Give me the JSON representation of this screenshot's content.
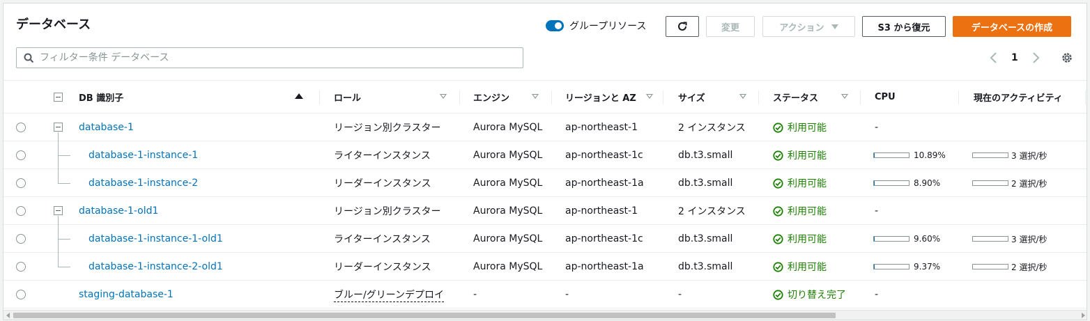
{
  "header": {
    "title": "データベース",
    "group_toggle_label": "グループリソース",
    "modify_label": "変更",
    "actions_label": "アクション",
    "restore_label": "S3 から復元",
    "create_label": "データベースの作成"
  },
  "search": {
    "placeholder": "フィルター条件 データベース"
  },
  "pager": {
    "page": "1"
  },
  "columns": {
    "db_id": "DB 識別子",
    "role": "ロール",
    "engine": "エンジン",
    "region": "リージョンと AZ",
    "size": "サイズ",
    "status": "ステータス",
    "cpu": "CPU",
    "activity": "現在のアクティビティ"
  },
  "rows": [
    {
      "id": "database-1",
      "role": "リージョン別クラスター",
      "engine": "Aurora MySQL",
      "region": "ap-northeast-1",
      "size": "2 インスタンス",
      "status": "利用可能",
      "cpu": "-",
      "activity": ""
    },
    {
      "id": "database-1-instance-1",
      "role": "ライターインスタンス",
      "engine": "Aurora MySQL",
      "region": "ap-northeast-1c",
      "size": "db.t3.small",
      "status": "利用可能",
      "cpu": "10.89%",
      "cpu_value": 10.89,
      "activity": "3 選択/秒"
    },
    {
      "id": "database-1-instance-2",
      "role": "リーダーインスタンス",
      "engine": "Aurora MySQL",
      "region": "ap-northeast-1a",
      "size": "db.t3.small",
      "status": "利用可能",
      "cpu": "8.90%",
      "cpu_value": 8.9,
      "activity": "2 選択/秒"
    },
    {
      "id": "database-1-old1",
      "role": "リージョン別クラスター",
      "engine": "Aurora MySQL",
      "region": "ap-northeast-1",
      "size": "2 インスタンス",
      "status": "利用可能",
      "cpu": "-",
      "activity": ""
    },
    {
      "id": "database-1-instance-1-old1",
      "role": "ライターインスタンス",
      "engine": "Aurora MySQL",
      "region": "ap-northeast-1c",
      "size": "db.t3.small",
      "status": "利用可能",
      "cpu": "9.60%",
      "cpu_value": 9.6,
      "activity": "3 選択/秒"
    },
    {
      "id": "database-1-instance-2-old1",
      "role": "リーダーインスタンス",
      "engine": "Aurora MySQL",
      "region": "ap-northeast-1a",
      "size": "db.t3.small",
      "status": "利用可能",
      "cpu": "9.37%",
      "cpu_value": 9.37,
      "activity": "2 選択/秒"
    },
    {
      "id": "staging-database-1",
      "role": "ブルー/グリーンデプロイ",
      "engine": "-",
      "region": "-",
      "size": "-",
      "status": "切り替え完了",
      "cpu": "-",
      "activity": ""
    }
  ],
  "colors": {
    "accent": "#0073bb",
    "primary": "#ec7211",
    "success": "#1d8102"
  },
  "icons": {
    "refresh": "refresh-icon",
    "settings": "gear-icon",
    "search": "search-icon",
    "status": "check-circle-icon"
  }
}
